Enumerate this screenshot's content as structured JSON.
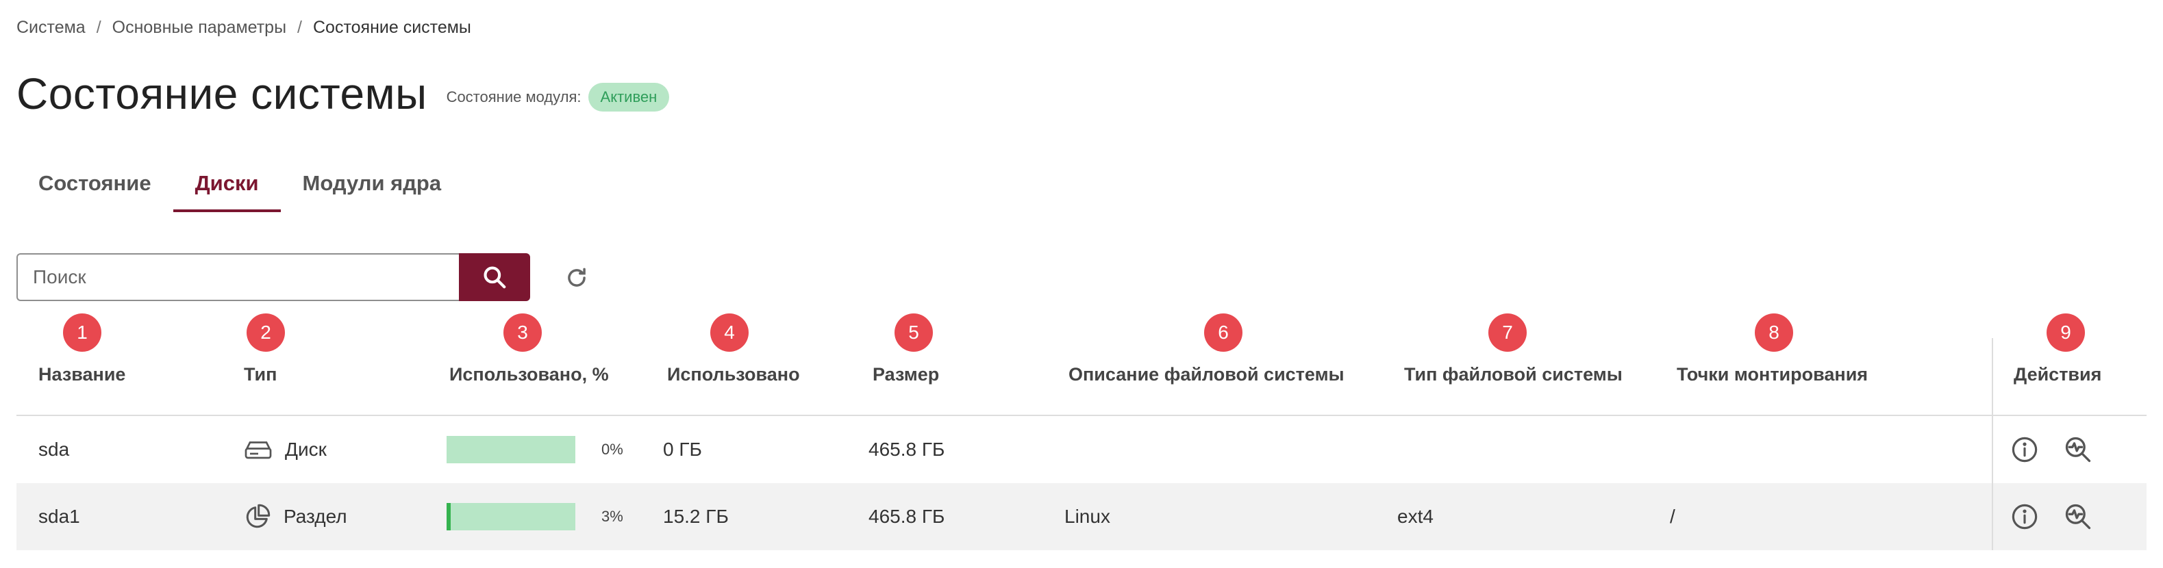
{
  "breadcrumb": [
    "Система",
    "Основные параметры",
    "Состояние системы"
  ],
  "page_title": "Состояние системы",
  "module_state": {
    "label": "Состояние модуля:",
    "value": "Активен"
  },
  "tabs": [
    {
      "label": "Состояние",
      "active": false
    },
    {
      "label": "Диски",
      "active": true
    },
    {
      "label": "Модули ядра",
      "active": false
    }
  ],
  "search": {
    "placeholder": "Поиск",
    "value": ""
  },
  "column_markers": [
    "1",
    "2",
    "3",
    "4",
    "5",
    "6",
    "7",
    "8",
    "9"
  ],
  "columns": [
    "Название",
    "Тип",
    "Использовано, %",
    "Использовано",
    "Размер",
    "Описание файловой системы",
    "Тип файловой системы",
    "Точки монтирования",
    "Действия"
  ],
  "rows": [
    {
      "name": "sda",
      "type": "Диск",
      "type_icon": "hard-drive-icon",
      "used_percent": 0,
      "used_percent_label": "0%",
      "used": "0 ГБ",
      "size": "465.8 ГБ",
      "fs_description": "",
      "fs_type": "",
      "mount_points": ""
    },
    {
      "name": "sda1",
      "type": "Раздел",
      "type_icon": "pie-chart-icon",
      "used_percent": 3,
      "used_percent_label": "3%",
      "used": "15.2 ГБ",
      "size": "465.8 ГБ",
      "fs_description": "Linux",
      "fs_type": "ext4",
      "mount_points": "/"
    }
  ],
  "colors": {
    "accent": "#7b1630",
    "badge_bg": "#b7e6c6",
    "badge_text": "#2f9e5a",
    "marker": "#e8484f",
    "usage_bar": "#b7e6c6",
    "usage_fill": "#35b34f"
  }
}
